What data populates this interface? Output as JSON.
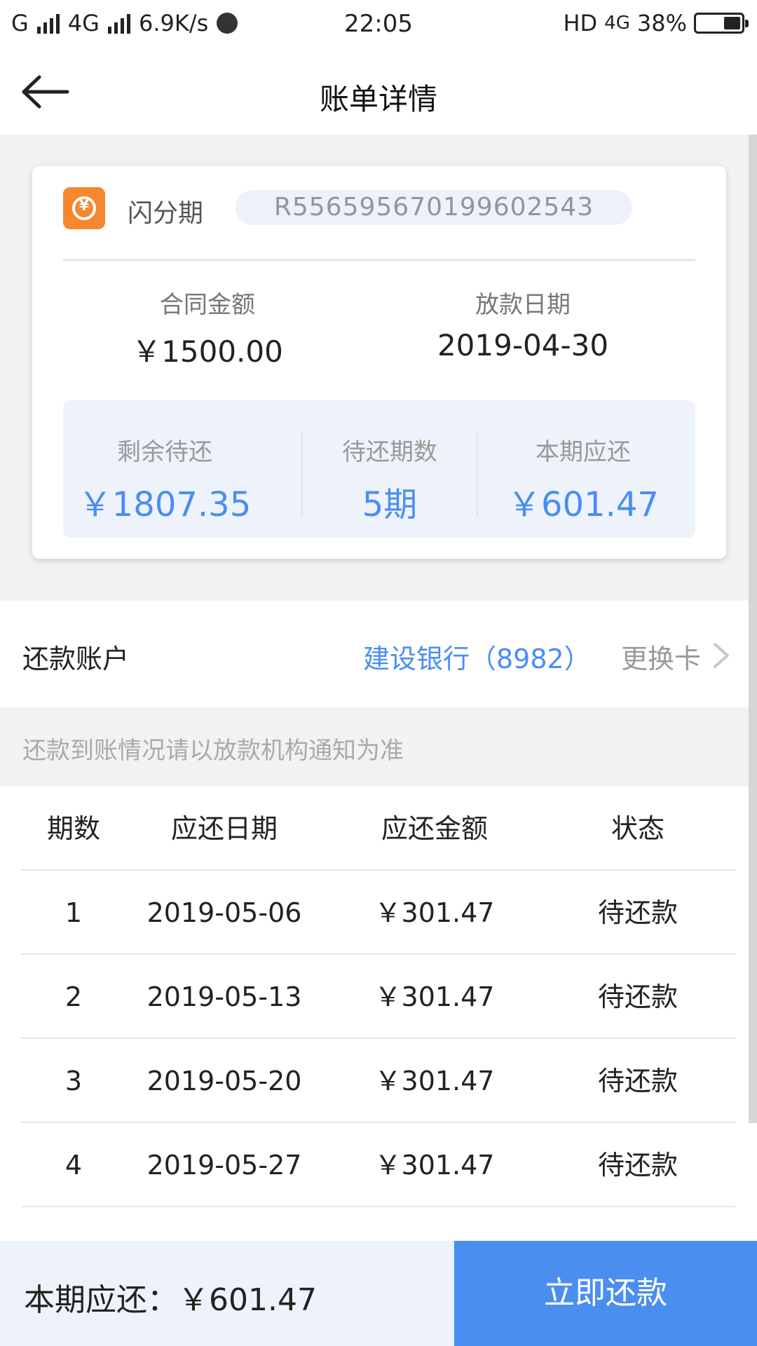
{
  "status_bar": {
    "carrier": "G",
    "network": "4G",
    "speed": "6.9K/s",
    "time": "22:05",
    "hd": "HD",
    "net2": "4G",
    "battery_pct": "38%",
    "battery_level": 0.38
  },
  "header": {
    "title": "账单详情",
    "back_icon": "back-arrow-icon"
  },
  "loan_card": {
    "product_name": "闪分期",
    "contract_no": "R556595670199602543",
    "contract_amount_label": "合同金额",
    "contract_amount": "￥1500.00",
    "loan_date_label": "放款日期",
    "loan_date": "2019-04-30",
    "stats": [
      {
        "label": "剩余待还",
        "value": "￥1807.35"
      },
      {
        "label": "待还期数",
        "value": "5期"
      },
      {
        "label": "本期应还",
        "value": "￥601.47"
      }
    ]
  },
  "account": {
    "label": "还款账户",
    "bank": "建设银行（8982）",
    "change_label": "更换卡"
  },
  "notice": "还款到账情况请以放款机构通知为准",
  "table": {
    "headers": [
      "期数",
      "应还日期",
      "应还金额",
      "状态"
    ],
    "rows": [
      [
        "1",
        "2019-05-06",
        "￥301.47",
        "待还款"
      ],
      [
        "2",
        "2019-05-13",
        "￥301.47",
        "待还款"
      ],
      [
        "3",
        "2019-05-20",
        "￥301.47",
        "待还款"
      ],
      [
        "4",
        "2019-05-27",
        "￥301.47",
        "待还款"
      ]
    ]
  },
  "bottom_bar": {
    "current_due_label": "本期应还：￥601.47",
    "pay_button": "立即还款"
  },
  "colors": {
    "accent": "#4a8ef0",
    "logo": "#f5872e"
  }
}
